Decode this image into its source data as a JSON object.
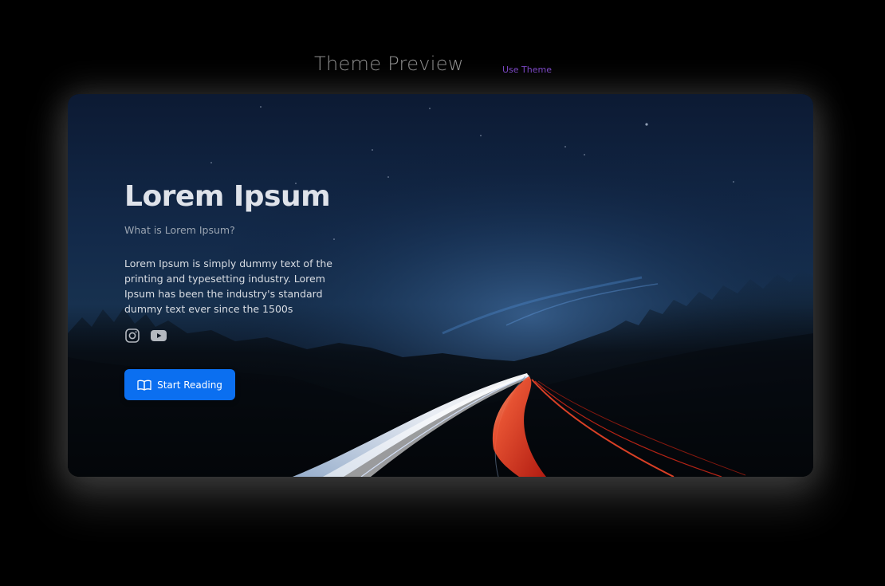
{
  "header": {
    "title": "Theme Preview",
    "use_theme_label": "Use Theme"
  },
  "hero": {
    "title": "Lorem Ipsum",
    "subtitle": "What is Lorem Ipsum?",
    "body": "Lorem Ipsum is simply dummy text of the printing and typesetting industry. Lorem Ipsum has been the industry's standard dummy text ever since the 1500s",
    "social": [
      "instagram-icon",
      "youtube-icon"
    ],
    "cta_label": "Start Reading",
    "cta_icon": "book-icon"
  },
  "colors": {
    "page_background": "#000000",
    "link_purple": "#7a45c4",
    "button_blue": "#0b6ff0"
  }
}
